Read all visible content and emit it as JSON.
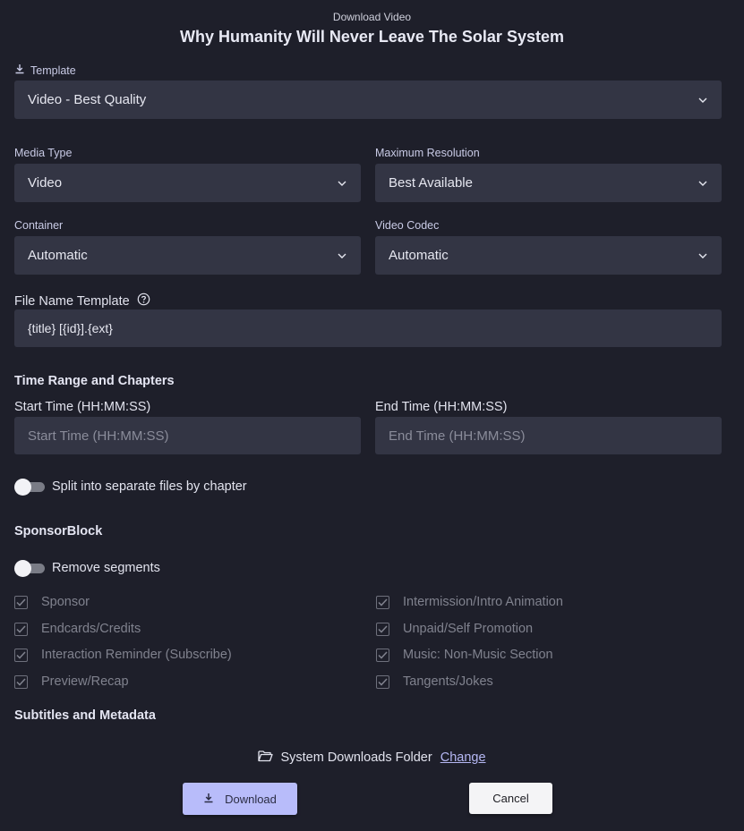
{
  "header": {
    "subtitle": "Download Video",
    "title": "Why Humanity Will Never Leave The Solar System"
  },
  "template": {
    "label": "Template",
    "value": "Video - Best Quality"
  },
  "media_type": {
    "label": "Media Type",
    "value": "Video"
  },
  "max_resolution": {
    "label": "Maximum Resolution",
    "value": "Best Available"
  },
  "container": {
    "label": "Container",
    "value": "Automatic"
  },
  "video_codec": {
    "label": "Video Codec",
    "value": "Automatic"
  },
  "file_name_template": {
    "label": "File Name Template",
    "value": "{title} [{id}].{ext}"
  },
  "time_range": {
    "title": "Time Range and Chapters",
    "start_label": "Start Time (HH:MM:SS)",
    "start_placeholder": "Start Time (HH:MM:SS)",
    "end_label": "End Time (HH:MM:SS)",
    "end_placeholder": "End Time (HH:MM:SS)",
    "split_label": "Split into separate files by chapter"
  },
  "sponsorblock": {
    "title": "SponsorBlock",
    "remove_label": "Remove segments",
    "left": [
      "Sponsor",
      "Endcards/Credits",
      "Interaction Reminder (Subscribe)",
      "Preview/Recap"
    ],
    "right": [
      "Intermission/Intro Animation",
      "Unpaid/Self Promotion",
      "Music: Non-Music Section",
      "Tangents/Jokes"
    ]
  },
  "subtitles": {
    "title": "Subtitles and Metadata"
  },
  "footer": {
    "folder_text": "System Downloads Folder",
    "change_label": "Change",
    "download_label": "Download",
    "cancel_label": "Cancel"
  },
  "colors": {
    "background": "#1e1f2a",
    "field": "#333544",
    "accent": "#b8bcfa"
  }
}
